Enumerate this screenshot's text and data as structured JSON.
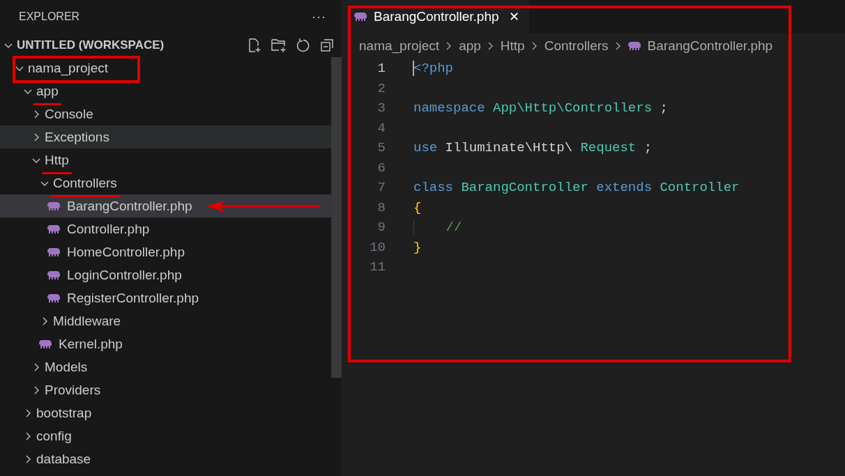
{
  "sidebar": {
    "title": "EXPLORER",
    "more": "···",
    "workspace": {
      "label": "UNTITLED (WORKSPACE)",
      "expanded": true,
      "children": [
        {
          "label": "nama_project",
          "kind": "folder",
          "expanded": true,
          "selected": false,
          "hovered": false,
          "annotation": {
            "kind": "box"
          },
          "children": [
            {
              "label": "app",
              "kind": "folder",
              "expanded": true,
              "selected": false,
              "hovered": false,
              "annotation": {
                "kind": "underline"
              },
              "children": [
                {
                  "label": "Console",
                  "kind": "folder",
                  "expanded": false,
                  "selected": false,
                  "hovered": false
                },
                {
                  "label": "Exceptions",
                  "kind": "folder",
                  "expanded": false,
                  "selected": false,
                  "hovered": true
                },
                {
                  "label": "Http",
                  "kind": "folder",
                  "expanded": true,
                  "selected": false,
                  "hovered": false,
                  "annotation": {
                    "kind": "underline"
                  },
                  "children": [
                    {
                      "label": "Controllers",
                      "kind": "folder",
                      "expanded": true,
                      "selected": false,
                      "hovered": false,
                      "annotation": {
                        "kind": "underline"
                      },
                      "children": [
                        {
                          "label": "BarangController.php",
                          "kind": "file",
                          "selected": true,
                          "hovered": false,
                          "annotation": {
                            "kind": "arrow"
                          }
                        },
                        {
                          "label": "Controller.php",
                          "kind": "file",
                          "selected": false,
                          "hovered": false
                        },
                        {
                          "label": "HomeController.php",
                          "kind": "file",
                          "selected": false,
                          "hovered": false
                        },
                        {
                          "label": "LoginController.php",
                          "kind": "file",
                          "selected": false,
                          "hovered": false
                        },
                        {
                          "label": "RegisterController.php",
                          "kind": "file",
                          "selected": false,
                          "hovered": false
                        }
                      ]
                    },
                    {
                      "label": "Middleware",
                      "kind": "folder",
                      "expanded": false,
                      "selected": false,
                      "hovered": false
                    },
                    {
                      "label": "Kernel.php",
                      "kind": "file",
                      "selected": false,
                      "hovered": false
                    }
                  ]
                },
                {
                  "label": "Models",
                  "kind": "folder",
                  "expanded": false,
                  "selected": false,
                  "hovered": false
                },
                {
                  "label": "Providers",
                  "kind": "folder",
                  "expanded": false,
                  "selected": false,
                  "hovered": false
                }
              ]
            },
            {
              "label": "bootstrap",
              "kind": "folder",
              "expanded": false,
              "selected": false,
              "hovered": false
            },
            {
              "label": "config",
              "kind": "folder",
              "expanded": false,
              "selected": false,
              "hovered": false
            },
            {
              "label": "database",
              "kind": "folder",
              "expanded": false,
              "selected": false,
              "hovered": false
            }
          ]
        }
      ]
    }
  },
  "editor": {
    "outlined": true,
    "tabs": [
      {
        "label": "BarangController.php",
        "close": "✕",
        "selected": true
      }
    ],
    "breadcrumb": [
      "nama_project",
      "app",
      "Http",
      "Controllers",
      "BarangController.php"
    ],
    "lines": [
      {
        "number": "1",
        "active": true,
        "indented": false,
        "tokens": [
          {
            "text": "<?php",
            "kind": "keyword"
          }
        ]
      },
      {
        "number": "2",
        "active": false,
        "indented": false
      },
      {
        "number": "3",
        "active": false,
        "indented": false,
        "tokens": [
          {
            "text": "namespace",
            "kind": "keyword"
          },
          {
            "text": "App\\Http\\Controllers",
            "kind": "type"
          },
          {
            "text": ";",
            "kind": "plain"
          }
        ]
      },
      {
        "number": "4",
        "active": false,
        "indented": false
      },
      {
        "number": "5",
        "active": false,
        "indented": false,
        "tokens": [
          {
            "text": "use",
            "kind": "keyword"
          },
          {
            "text": "Illuminate\\Http\\",
            "kind": "plain"
          },
          {
            "text": "Request",
            "kind": "type"
          },
          {
            "text": ";",
            "kind": "plain"
          }
        ]
      },
      {
        "number": "6",
        "active": false,
        "indented": false
      },
      {
        "number": "7",
        "active": false,
        "indented": false,
        "tokens": [
          {
            "text": "class",
            "kind": "keyword"
          },
          {
            "text": "BarangController",
            "kind": "type"
          },
          {
            "text": "extends",
            "kind": "keyword"
          },
          {
            "text": "Controller",
            "kind": "type"
          }
        ]
      },
      {
        "number": "8",
        "active": false,
        "indented": false,
        "tokens": [
          {
            "text": "{",
            "kind": "brace"
          }
        ]
      },
      {
        "number": "9",
        "active": false,
        "indented": true,
        "tokens": [
          {
            "text": "//",
            "kind": "comment"
          }
        ]
      },
      {
        "number": "10",
        "active": false,
        "indented": false,
        "tokens": [
          {
            "text": "}",
            "kind": "brace"
          }
        ]
      },
      {
        "number": "11",
        "active": false,
        "indented": false
      }
    ]
  }
}
